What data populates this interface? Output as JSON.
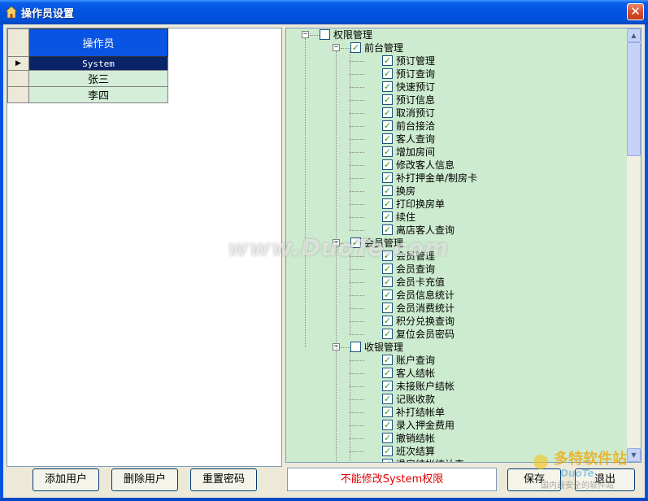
{
  "window": {
    "title": "操作员设置"
  },
  "operators": {
    "header": "操作员",
    "rows": [
      {
        "name": "System",
        "selected": true
      },
      {
        "name": "张三",
        "selected": false
      },
      {
        "name": "李四",
        "selected": false
      }
    ]
  },
  "tree": {
    "root": {
      "label": "权限管理",
      "checked": false
    },
    "groups": [
      {
        "label": "前台管理",
        "checked": true,
        "items": [
          "预订管理",
          "预订查询",
          "快速预订",
          "预订信息",
          "取消预订",
          "前台接洽",
          "客人查询",
          "增加房间",
          "修改客人信息",
          "补打押金单/制房卡",
          "换房",
          "打印换房单",
          "续住",
          "离店客人查询"
        ]
      },
      {
        "label": "会员管理",
        "checked": true,
        "items": [
          "会员管理",
          "会员查询",
          "会员卡充值",
          "会员信息统计",
          "会员消费统计",
          "积分兑换查询",
          "复位会员密码"
        ]
      },
      {
        "label": "收银管理",
        "checked": false,
        "items": [
          "账户查询",
          "客人结帐",
          "未接账户结帐",
          "记账收款",
          "补打结帐单",
          "录入押金费用",
          "撤销结帐",
          "班次结算",
          "退房结帐统计表"
        ]
      }
    ]
  },
  "buttons": {
    "add_user": "添加用户",
    "delete_user": "删除用户",
    "reset_password": "重置密码",
    "save": "保存",
    "exit": "退出"
  },
  "status_message": "不能修改System权限",
  "watermarks": {
    "center": "www.DuoTe.com",
    "corner_cn": "多特软件站",
    "corner_en": "DuoTe",
    "corner_sub": "国内最安全的软件站"
  },
  "colors": {
    "title_bar": "#0054E3",
    "grid_header": "#0954E3",
    "tree_background": "#CDEBCF",
    "status_text": "#E00000",
    "check_mark": "#21A121"
  }
}
